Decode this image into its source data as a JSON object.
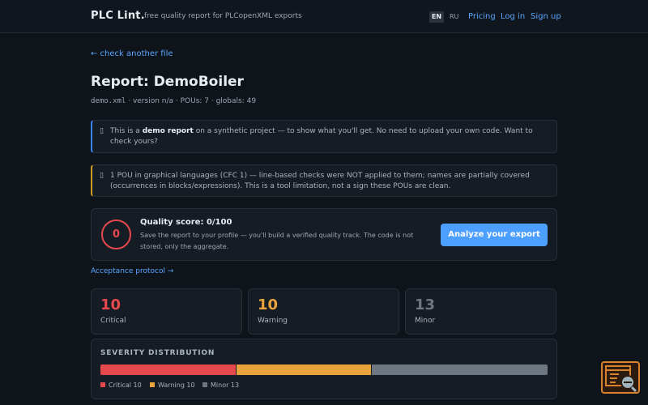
{
  "header": {
    "brand": "PLC Lint.",
    "tagline": "free quality report for PLCopenXML exports",
    "lang_active": "EN",
    "lang_other": "RU",
    "nav": [
      "Pricing",
      "Log in",
      "Sign up"
    ]
  },
  "back_link": "← check another file",
  "title": "Report: DemoBoiler",
  "meta": {
    "filename": "demo.xml",
    "rest": " · version n/a · POUs: 7 · globals: 49"
  },
  "notice_demo": {
    "icon": "info-icon",
    "pre": "This is a ",
    "bold": "demo report",
    "post": " on a synthetic project — to show what you'll get. No need to upload your own code. Want to check yours?"
  },
  "notice_graphical": {
    "icon": "warning-icon",
    "text": "1 POU in graphical languages (CFC 1) — line-based checks were NOT applied to them; names are partially covered (occurrences in blocks/expressions). This is a tool limitation, not a sign these POUs are clean."
  },
  "score": {
    "value": "0",
    "title": "Quality score: 0/100",
    "description": "Save the report to your profile — you'll build a verified quality track. The code is not stored, only the aggregate.",
    "button": "Analyze your export"
  },
  "acceptance_link": "Acceptance protocol →",
  "stats": [
    {
      "value": "10",
      "label": "Critical",
      "color": "#e5484d"
    },
    {
      "value": "10",
      "label": "Warning",
      "color": "#e8a33d"
    },
    {
      "value": "13",
      "label": "Minor",
      "color": "#6e7681"
    }
  ],
  "distribution": {
    "title": "SEVERITY DISTRIBUTION",
    "segments": [
      {
        "name": "Critical",
        "count": 10,
        "label": "Critical 10",
        "color": "#e5484d"
      },
      {
        "name": "Warning",
        "count": 10,
        "label": "Warning 10",
        "color": "#e8a33d"
      },
      {
        "name": "Minor",
        "count": 13,
        "label": "Minor 13",
        "color": "#6e7681"
      }
    ]
  },
  "widget": {
    "icon": "report-search-icon"
  }
}
